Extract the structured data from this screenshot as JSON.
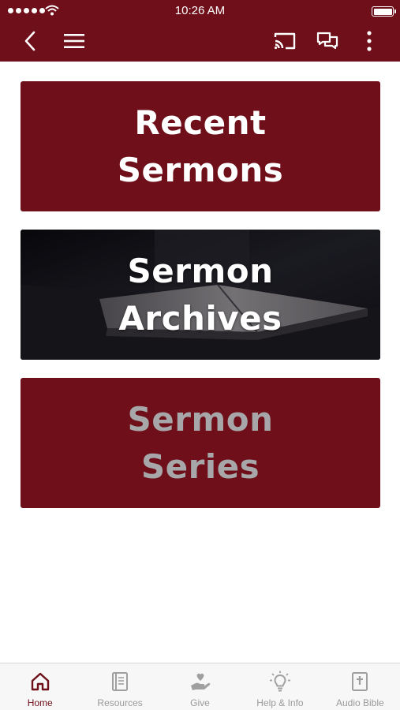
{
  "status_bar": {
    "time": "10:26 AM"
  },
  "nav": {
    "back_icon": "chevron-left-icon",
    "menu_icon": "hamburger-menu-icon",
    "cast_icon": "cast-icon",
    "chat_icon": "chat-icon",
    "more_icon": "more-vertical-icon"
  },
  "colors": {
    "brand": "#6e0f19",
    "inactive_text": "#9a9a9a",
    "series_text": "#a7a7a9"
  },
  "tiles": [
    {
      "label": "Recent\nSermons"
    },
    {
      "label": "Sermon\nArchives"
    },
    {
      "label": "Sermon\nSeries"
    }
  ],
  "tabbar": {
    "tabs": [
      {
        "label": "Home",
        "icon": "home-icon",
        "active": true
      },
      {
        "label": "Resources",
        "icon": "book-icon",
        "active": false
      },
      {
        "label": "Give",
        "icon": "give-hand-heart-icon",
        "active": false
      },
      {
        "label": "Help & Info",
        "icon": "lightbulb-icon",
        "active": false
      },
      {
        "label": "Audio Bible",
        "icon": "bible-icon",
        "active": false
      }
    ]
  }
}
